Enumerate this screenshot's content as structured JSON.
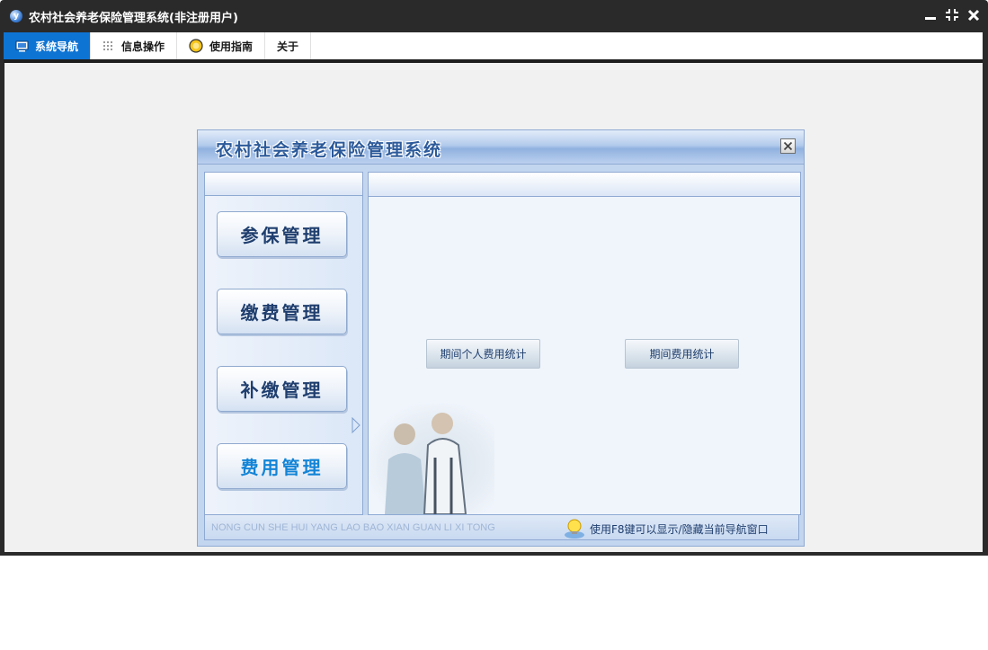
{
  "window": {
    "title": "农村社会养老保险管理系统(非注册用户)"
  },
  "menu": {
    "tabs": [
      {
        "label": "系统导航",
        "icon": "monitor-icon",
        "active": true
      },
      {
        "label": "信息操作",
        "icon": "grid-icon",
        "active": false
      },
      {
        "label": "使用指南",
        "icon": "help-circle-icon",
        "active": false
      },
      {
        "label": "关于",
        "icon": "",
        "active": false
      }
    ]
  },
  "dialog": {
    "title": "农村社会养老保险管理系统",
    "nav_buttons": [
      {
        "label": "参保管理"
      },
      {
        "label": "缴费管理"
      },
      {
        "label": "补缴管理"
      },
      {
        "label": "费用管理",
        "selected": true
      }
    ],
    "function_buttons": [
      {
        "label": "期间个人费用统计"
      },
      {
        "label": "期间费用统计"
      }
    ],
    "footer": {
      "pinyin": "NONG CUN SHE HUI YANG LAO BAO XIAN GUAN LI XI TONG",
      "hint": "使用F8键可以显示/隐藏当前导航窗口"
    }
  },
  "colors": {
    "active_tab": "#0e74d4",
    "title_text": "#2c5a9a",
    "nav_text": "#1f3e6e",
    "selected_nav_text": "#1384d6",
    "dialog_frame": "#c3d6ef"
  }
}
